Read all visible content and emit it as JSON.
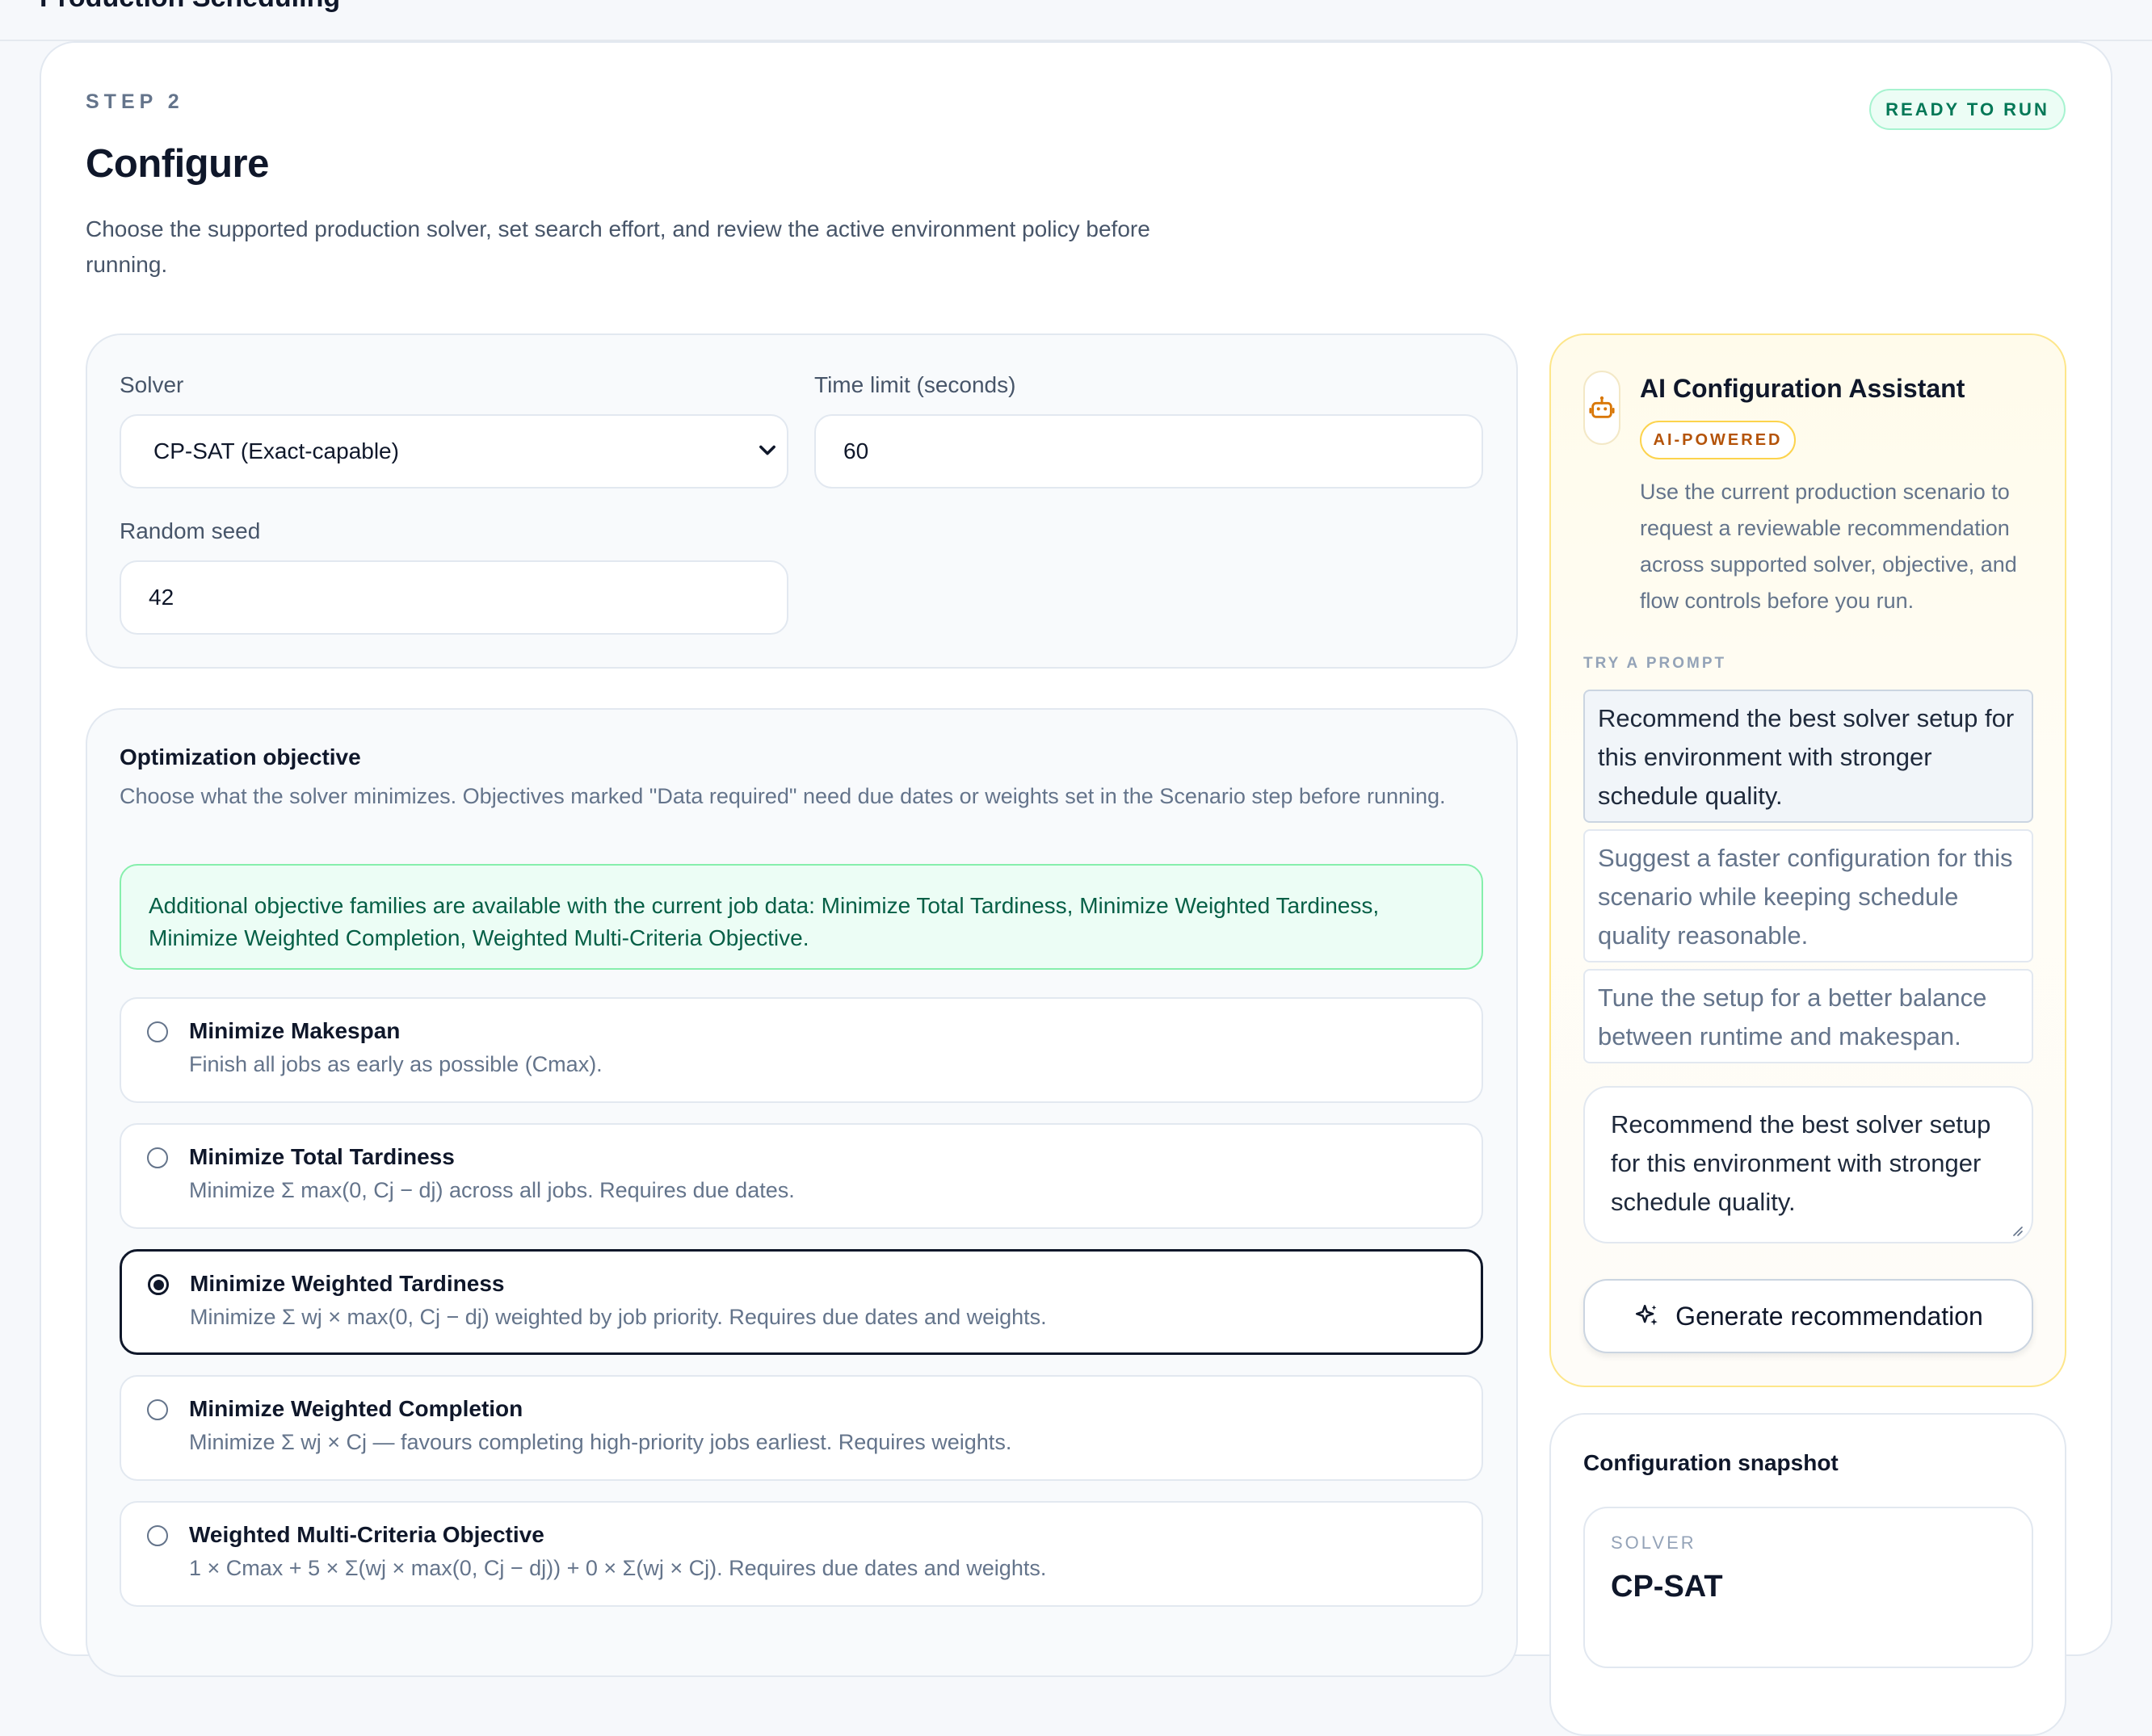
{
  "app": {
    "title": "Production Scheduling"
  },
  "step": {
    "label": "STEP 2",
    "title": "Configure",
    "status": "READY TO RUN",
    "description": "Choose the supported production solver, set search effort, and review the active environment policy before running."
  },
  "settings": {
    "solver_label": "Solver",
    "solver_value": "CP-SAT (Exact-capable)",
    "time_limit_label": "Time limit (seconds)",
    "time_limit_value": "60",
    "seed_label": "Random seed",
    "seed_value": "42"
  },
  "objective": {
    "title": "Optimization objective",
    "description": "Choose what the solver minimizes. Objectives marked \"Data required\" need due dates or weights set in the Scenario step before running.",
    "info": "Additional objective families are available with the current job data: Minimize Total Tardiness, Minimize Weighted Tardiness, Minimize Weighted Completion, Weighted Multi-Criteria Objective.",
    "selected_index": 2,
    "options": [
      {
        "title": "Minimize Makespan",
        "desc": "Finish all jobs as early as possible (Cmax)."
      },
      {
        "title": "Minimize Total Tardiness",
        "desc": "Minimize Σ max(0, Cj − dj) across all jobs. Requires due dates."
      },
      {
        "title": "Minimize Weighted Tardiness",
        "desc": "Minimize Σ wj × max(0, Cj − dj) weighted by job priority. Requires due dates and weights."
      },
      {
        "title": "Minimize Weighted Completion",
        "desc": "Minimize Σ wj × Cj — favours completing high-priority jobs earliest. Requires weights."
      },
      {
        "title": "Weighted Multi-Criteria Objective",
        "desc": "1 × Cmax + 5 × Σ(wj × max(0, Cj − dj)) + 0 × Σ(wj × Cj). Requires due dates and weights."
      }
    ]
  },
  "assistant": {
    "title": "AI Configuration Assistant",
    "badge": "AI-POWERED",
    "description": "Use the current production scenario to request a reviewable recommendation across supported solver, objective, and flow controls before you run.",
    "try_label": "TRY A PROMPT",
    "prompts": [
      "Recommend the best solver setup for this environment with stronger schedule quality.",
      "Suggest a faster configuration for this scenario while keeping schedule quality reasonable.",
      "Tune the setup for a better balance between runtime and makespan."
    ],
    "textarea_value": "Recommend the best solver setup for this environment with stronger schedule quality.",
    "generate_label": "Generate recommendation",
    "icons": {
      "assistant": "robot-icon",
      "generate": "sparkles-icon"
    }
  },
  "snapshot": {
    "title": "Configuration snapshot",
    "solver_key": "SOLVER",
    "solver_value": "CP-SAT"
  },
  "colors": {
    "accent_green": "#047857",
    "accent_amber": "#b45309",
    "selected_border": "#0f172a"
  }
}
